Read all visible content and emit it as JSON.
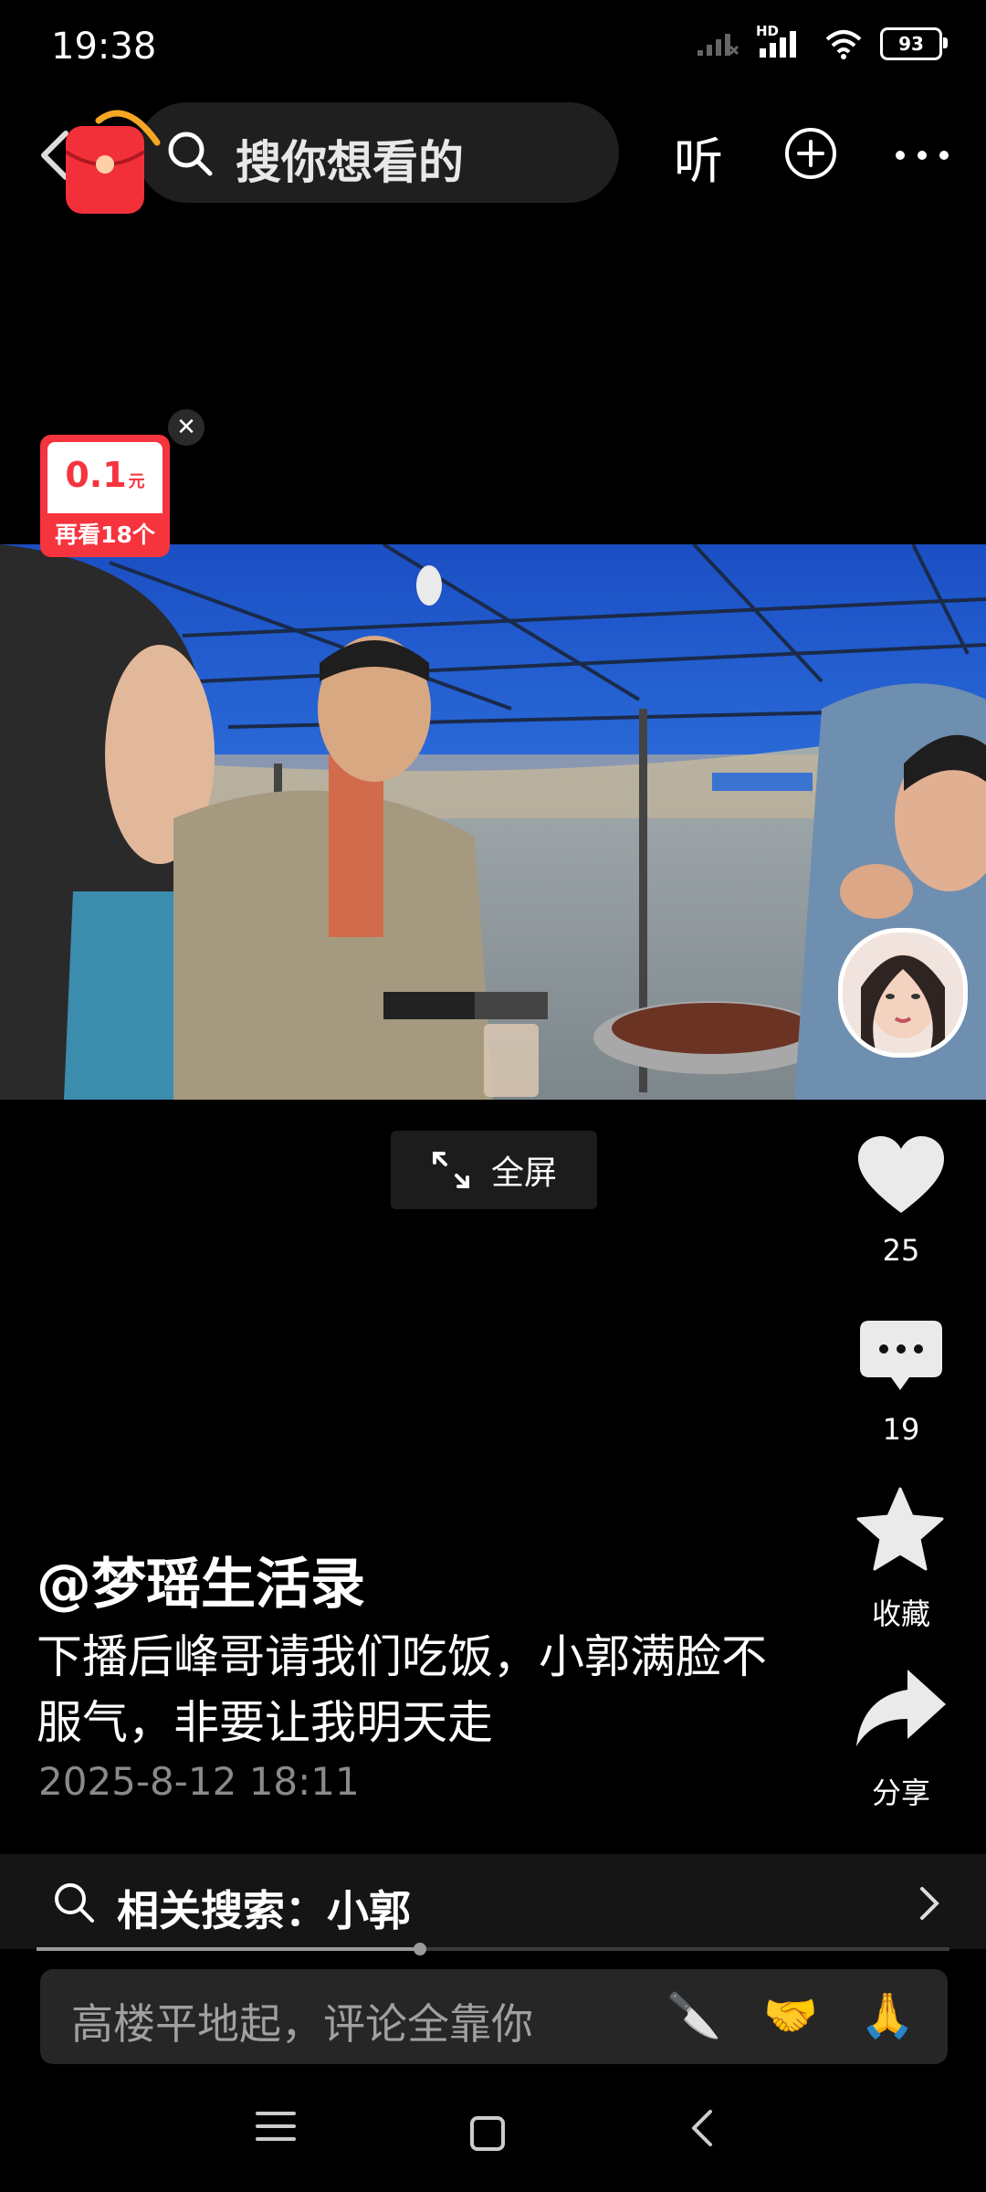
{
  "status_bar": {
    "time": "19:38",
    "network": "HD",
    "battery": "93"
  },
  "top_bar": {
    "search_placeholder": "搜你想看的",
    "listen_label": "听"
  },
  "coin_card": {
    "value": "0.1",
    "unit": "元",
    "label": "再看18个"
  },
  "video": {
    "fullscreen_label": "全屏"
  },
  "actions": {
    "likes": "25",
    "comments": "19",
    "favorite_label": "收藏",
    "share_label": "分享"
  },
  "post": {
    "author": "@梦瑶生活录",
    "description": "下播后峰哥请我们吃饭，小郭满脸不服气，非要让我明天走",
    "date": "2025-8-12 18:11"
  },
  "related_search": {
    "label": "相关搜索：小郭"
  },
  "playback": {
    "progress_percent": 42
  },
  "comment_box": {
    "placeholder": "高楼平地起，评论全靠你",
    "quick_emojis": [
      "🔪",
      "🤝",
      "🙏"
    ]
  },
  "colors": {
    "accent_red": "#f5343e",
    "background": "#000000",
    "panel": "#262626"
  }
}
